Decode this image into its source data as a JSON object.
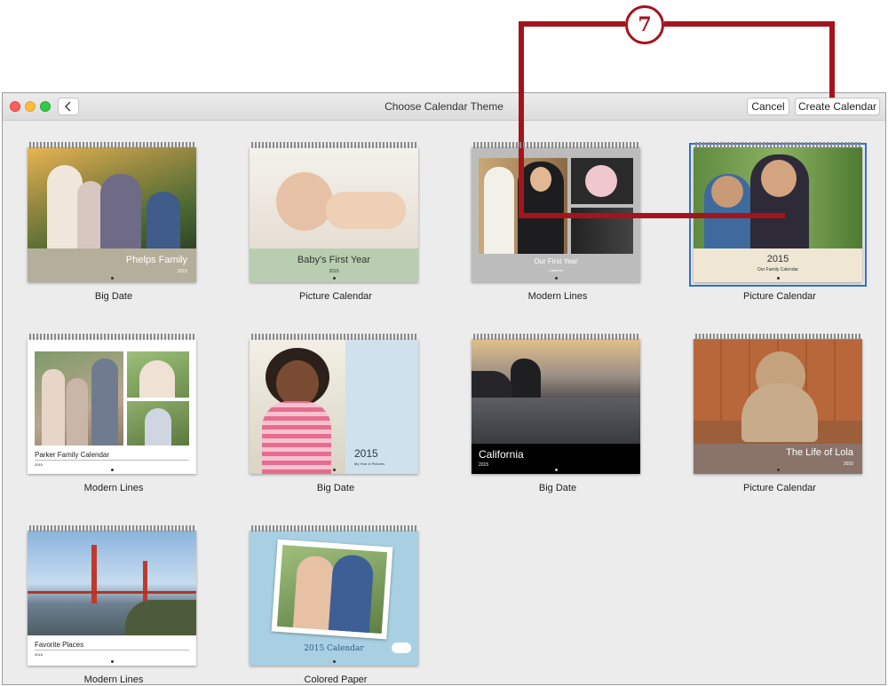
{
  "window": {
    "title": "Choose Calendar Theme",
    "cancel_label": "Cancel",
    "create_label": "Create Calendar"
  },
  "callout": {
    "number": "7"
  },
  "themes": [
    {
      "label": "Big Date",
      "caption": "Phelps Family",
      "year": "2015"
    },
    {
      "label": "Picture Calendar",
      "caption": "Baby's First Year",
      "year": "2015"
    },
    {
      "label": "Modern Lines",
      "caption": "Our First Year",
      "sub": "Calendar"
    },
    {
      "label": "Picture Calendar",
      "caption": "2015",
      "sub": "Our Family Calendar"
    },
    {
      "label": "Modern Lines",
      "caption": "Parker Family Calendar",
      "year": "2015"
    },
    {
      "label": "Big Date",
      "caption": "2015",
      "sub": "My Year in Pictures"
    },
    {
      "label": "Big Date",
      "caption": "California",
      "year": "2015"
    },
    {
      "label": "Picture Calendar",
      "caption": "The Life of Lola",
      "year": "2015"
    },
    {
      "label": "Modern Lines",
      "caption": "Favorite Places",
      "year": "2015"
    },
    {
      "label": "Colored Paper",
      "caption": "2015 Calendar"
    }
  ],
  "colors": {
    "accent": "#2f6fd0",
    "callout": "#a3141d"
  }
}
